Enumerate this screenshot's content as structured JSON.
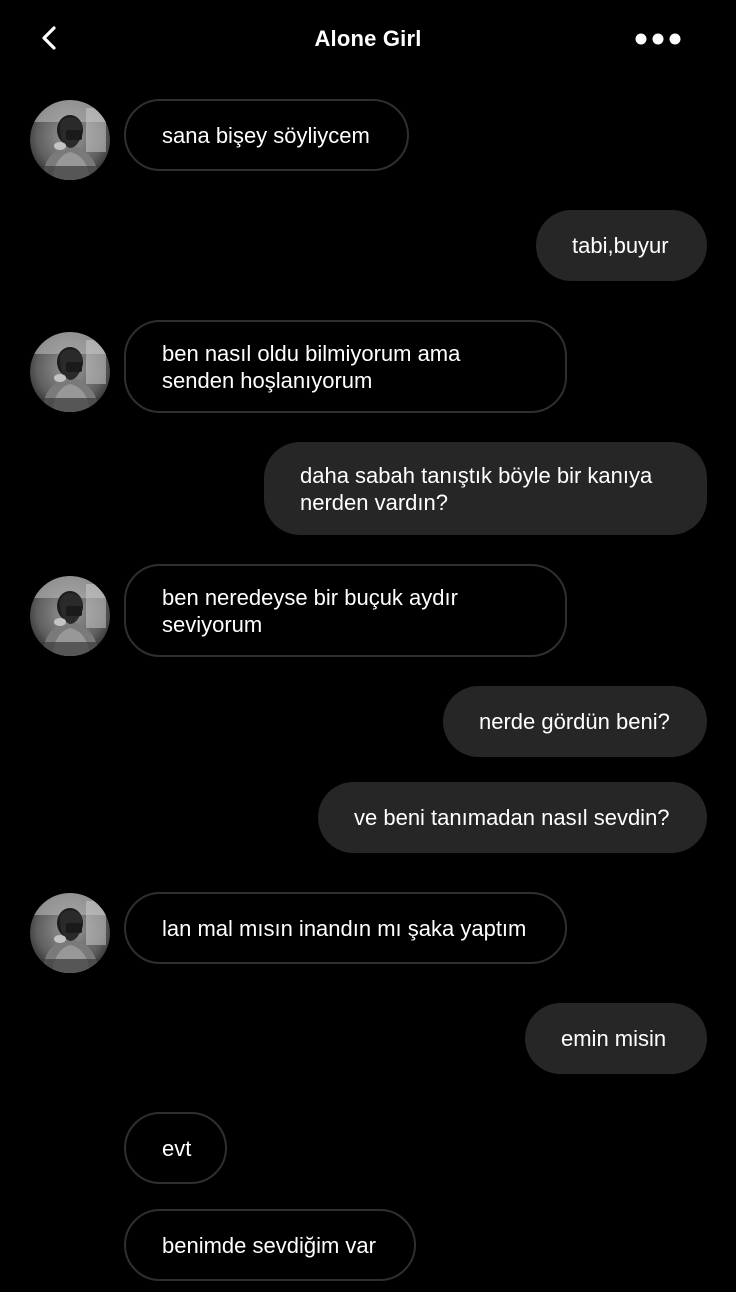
{
  "header": {
    "back_icon": "chevron-left-icon",
    "title": "Alone Girl",
    "more_icon": "more-dots-icon"
  },
  "avatar_icon": "contact-avatar-photo",
  "messages": [
    {
      "side": "incoming",
      "text": "sana bişey söyliycem"
    },
    {
      "side": "outgoing",
      "text": "tabi,buyur"
    },
    {
      "side": "incoming",
      "line1": "ben nasıl oldu bilmiyorum ama",
      "line2": "senden hoşlanıyorum"
    },
    {
      "side": "outgoing",
      "line1": "daha sabah tanıştık böyle bir kanıya",
      "line2": "nerden vardın?"
    },
    {
      "side": "incoming",
      "line1": "ben neredeyse bir buçuk aydır",
      "line2": "seviyorum"
    },
    {
      "side": "outgoing",
      "text": "nerde gördün beni?"
    },
    {
      "side": "outgoing",
      "text": "ve beni tanımadan nasıl sevdin?"
    },
    {
      "side": "incoming",
      "text": "lan mal mısın inandın mı şaka yaptım"
    },
    {
      "side": "outgoing",
      "text": "emin misin"
    },
    {
      "side": "incoming",
      "text": "evt"
    },
    {
      "side": "incoming",
      "text": "benimde sevdiğim var"
    }
  ],
  "colors": {
    "background": "#000000",
    "incoming_border": "#2f2f2f",
    "outgoing_bubble": "#262626",
    "text": "#ffffff"
  }
}
